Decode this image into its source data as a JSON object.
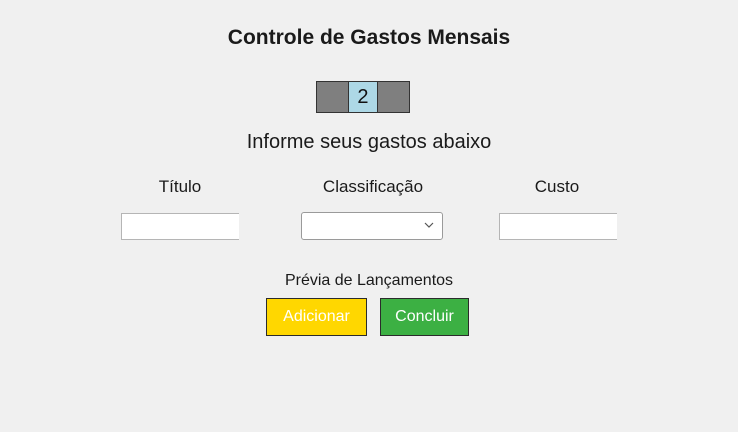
{
  "header": {
    "title": "Controle de Gastos Mensais"
  },
  "stepper": {
    "current_step": "2"
  },
  "form": {
    "subtitle": "Informe seus gastos abaixo",
    "columns": {
      "titulo": "Título",
      "classificacao": "Classificação",
      "custo": "Custo"
    },
    "values": {
      "titulo": "",
      "classificacao": "",
      "custo": ""
    }
  },
  "preview": {
    "label": "Prévia de Lançamentos"
  },
  "actions": {
    "add_label": "Adicionar",
    "done_label": "Concluir"
  },
  "colors": {
    "background": "#f0f0f0",
    "stepper_inactive": "#7f7f7f",
    "stepper_active": "#add8e6",
    "add_button": "#ffd700",
    "done_button": "#3cb043"
  },
  "icons": {
    "select_arrow": "chevron-down-icon"
  }
}
